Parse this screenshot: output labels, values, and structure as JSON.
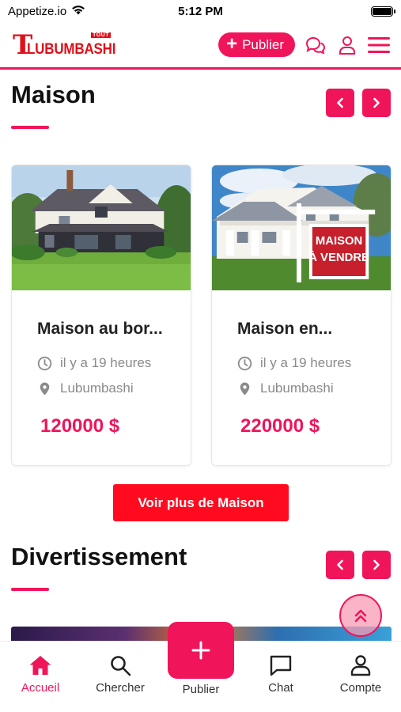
{
  "status_bar": {
    "carrier": "Appetize.io",
    "time": "5:12 PM"
  },
  "navbar": {
    "logo_letter": "T",
    "logo_word": "LUBUMBASHI",
    "logo_badge": "TOUT",
    "publish_label": "Publier"
  },
  "colors": {
    "accent": "#f0155b",
    "button_red": "#ff0a1f"
  },
  "sections": [
    {
      "title": "Maison",
      "cards": [
        {
          "title": "Maison au bor...",
          "time": "il y a 19 heures",
          "location": "Lubumbashi",
          "price": "120000 $"
        },
        {
          "title": "Maison en...",
          "time": "il y a 19 heures",
          "location": "Lubumbashi",
          "price": "220000 $",
          "sign_line1": "MAISON",
          "sign_line2": "À VENDRE"
        }
      ],
      "more_label": "Voir plus de Maison"
    },
    {
      "title": "Divertissement"
    }
  ],
  "tabbar": {
    "items": [
      {
        "label": "Accueil",
        "icon": "home-icon",
        "active": true
      },
      {
        "label": "Chercher",
        "icon": "search-icon",
        "active": false
      },
      {
        "label": "Publier",
        "icon": "plus-icon",
        "active": false
      },
      {
        "label": "Chat",
        "icon": "chat-icon",
        "active": false
      },
      {
        "label": "Compte",
        "icon": "user-icon",
        "active": false
      }
    ]
  }
}
